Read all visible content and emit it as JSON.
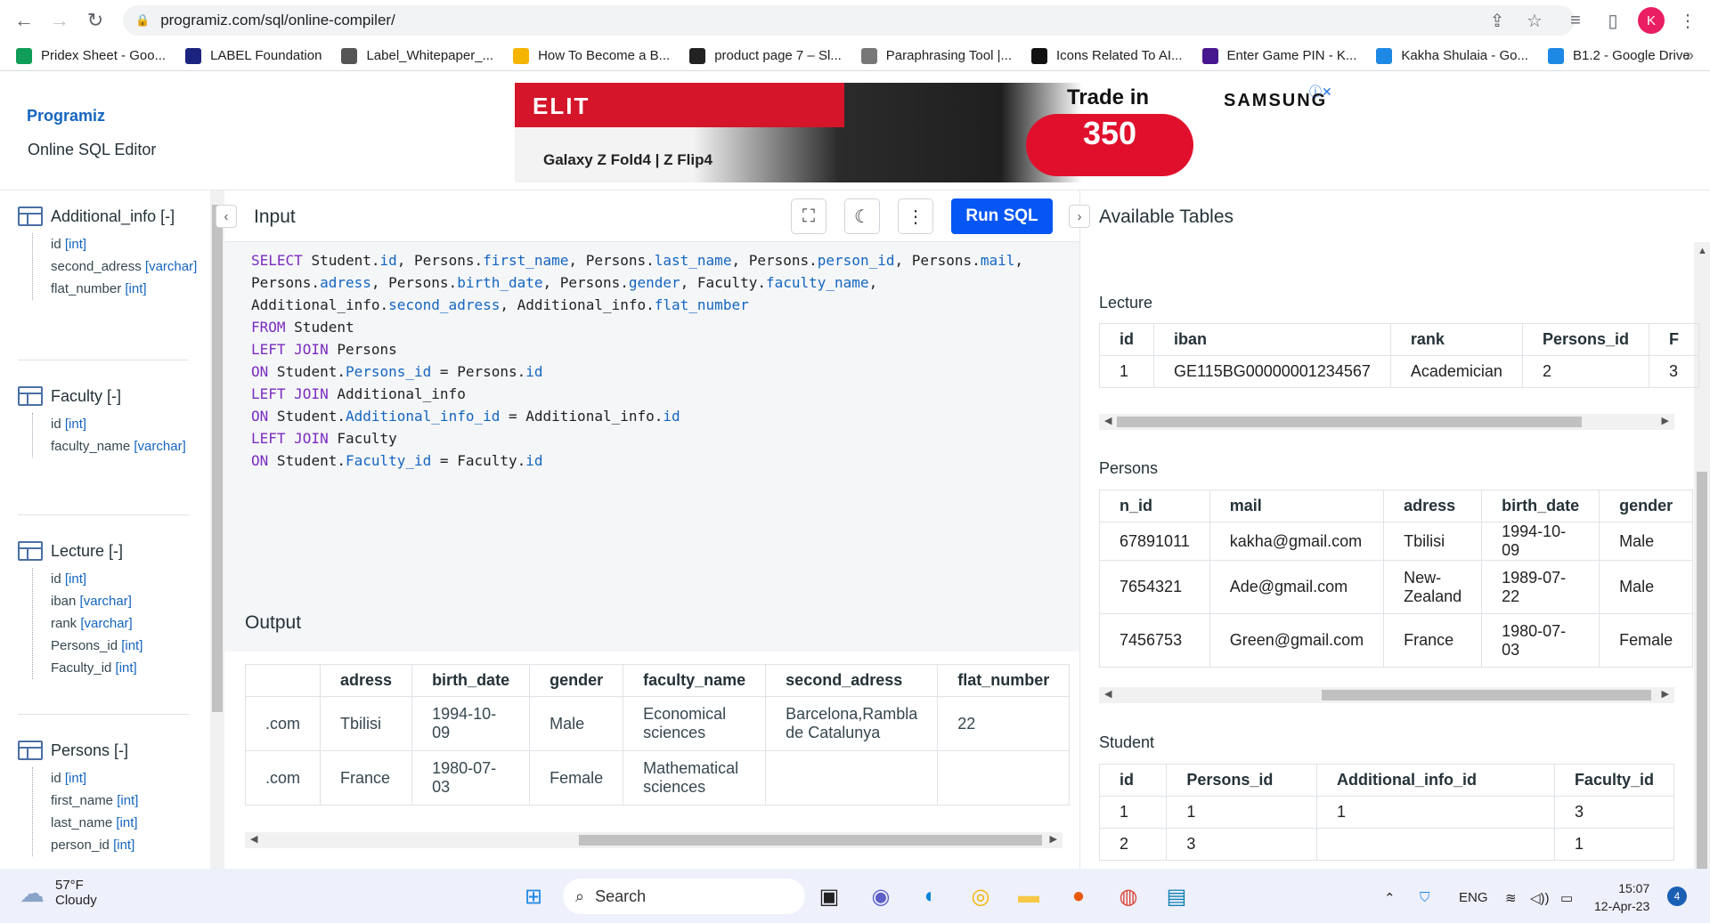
{
  "browser": {
    "url": "programiz.com/sql/online-compiler/",
    "profile_initial": "K",
    "bookmarks": [
      {
        "label": "Pridex Sheet - Goo...",
        "color": "#0f9d58"
      },
      {
        "label": "LABEL Foundation",
        "color": "#1a237e"
      },
      {
        "label": "Label_Whitepaper_...",
        "color": "#555555"
      },
      {
        "label": "How To Become a B...",
        "color": "#f4b400"
      },
      {
        "label": "product page 7 – Sl...",
        "color": "#222222"
      },
      {
        "label": "Paraphrasing Tool |...",
        "color": "#777777"
      },
      {
        "label": "Icons Related To AI...",
        "color": "#111111"
      },
      {
        "label": "Enter Game PIN - K...",
        "color": "#46178f"
      },
      {
        "label": "Kakha Shulaia - Go...",
        "color": "#1e88e5"
      },
      {
        "label": "B1.2 - Google Drive",
        "color": "#1e88e5"
      }
    ]
  },
  "header": {
    "logo": "Programiz",
    "subtitle": "Online SQL Editor"
  },
  "ad": {
    "brand1": "ELIT",
    "product": "Galaxy Z Fold4 | Z Flip4",
    "trade": "Trade in",
    "amount": "350",
    "brand2": "SAMSUNG"
  },
  "sidebar": {
    "tables": [
      {
        "name": "Additional_info [-]",
        "columns": [
          {
            "name": "id",
            "type": "[int]"
          },
          {
            "name": "second_adress",
            "type": "[varchar]"
          },
          {
            "name": "flat_number",
            "type": "[int]"
          }
        ]
      },
      {
        "name": "Faculty [-]",
        "columns": [
          {
            "name": "id",
            "type": "[int]"
          },
          {
            "name": "faculty_name",
            "type": "[varchar]"
          }
        ]
      },
      {
        "name": "Lecture [-]",
        "columns": [
          {
            "name": "id",
            "type": "[int]"
          },
          {
            "name": "iban",
            "type": "[varchar]"
          },
          {
            "name": "rank",
            "type": "[varchar]"
          },
          {
            "name": "Persons_id",
            "type": "[int]"
          },
          {
            "name": "Faculty_id",
            "type": "[int]"
          }
        ]
      },
      {
        "name": "Persons [-]",
        "columns": [
          {
            "name": "id",
            "type": "[int]"
          },
          {
            "name": "first_name",
            "type": "[int]"
          },
          {
            "name": "last_name",
            "type": "[int]"
          },
          {
            "name": "person_id",
            "type": "[int]"
          }
        ]
      }
    ]
  },
  "editor": {
    "title": "Input",
    "run_label": "Run SQL",
    "lines": [
      [
        {
          "t": "SELECT ",
          "c": "kw"
        },
        {
          "t": "Student.",
          "c": ""
        },
        {
          "t": "id",
          "c": "fd"
        },
        {
          "t": ", Persons.",
          "c": ""
        },
        {
          "t": "first_name",
          "c": "fd"
        },
        {
          "t": ", Persons.",
          "c": ""
        },
        {
          "t": "last_name",
          "c": "fd"
        },
        {
          "t": ", Persons.",
          "c": ""
        },
        {
          "t": "person_id",
          "c": "fd"
        },
        {
          "t": ", Persons.",
          "c": ""
        },
        {
          "t": "mail",
          "c": "fd"
        },
        {
          "t": ",",
          "c": ""
        }
      ],
      [
        {
          "t": "Persons.",
          "c": ""
        },
        {
          "t": "adress",
          "c": "fd"
        },
        {
          "t": ", Persons.",
          "c": ""
        },
        {
          "t": "birth_date",
          "c": "fd"
        },
        {
          "t": ", Persons.",
          "c": ""
        },
        {
          "t": "gender",
          "c": "fd"
        },
        {
          "t": ", Faculty.",
          "c": ""
        },
        {
          "t": "faculty_name",
          "c": "fd"
        },
        {
          "t": ",",
          "c": ""
        }
      ],
      [
        {
          "t": "Additional_info.",
          "c": ""
        },
        {
          "t": "second_adress",
          "c": "fd"
        },
        {
          "t": ", Additional_info.",
          "c": ""
        },
        {
          "t": "flat_number",
          "c": "fd"
        }
      ],
      [
        {
          "t": "FROM ",
          "c": "kw"
        },
        {
          "t": "Student",
          "c": ""
        }
      ],
      [
        {
          "t": "LEFT JOIN ",
          "c": "kw"
        },
        {
          "t": "Persons",
          "c": ""
        }
      ],
      [
        {
          "t": "ON ",
          "c": "kw"
        },
        {
          "t": "Student.",
          "c": ""
        },
        {
          "t": "Persons_id",
          "c": "fd"
        },
        {
          "t": " = Persons.",
          "c": ""
        },
        {
          "t": "id",
          "c": "fd"
        }
      ],
      [
        {
          "t": "LEFT JOIN ",
          "c": "kw"
        },
        {
          "t": "Additional_info",
          "c": ""
        }
      ],
      [
        {
          "t": "ON ",
          "c": "kw"
        },
        {
          "t": "Student.",
          "c": ""
        },
        {
          "t": "Additional_info_id",
          "c": "fd"
        },
        {
          "t": " = Additional_info.",
          "c": ""
        },
        {
          "t": "id",
          "c": "fd"
        }
      ],
      [
        {
          "t": "LEFT JOIN ",
          "c": "kw"
        },
        {
          "t": "Faculty",
          "c": ""
        }
      ],
      [
        {
          "t": "ON ",
          "c": "kw"
        },
        {
          "t": "Student.",
          "c": ""
        },
        {
          "t": "Faculty_id",
          "c": "fd"
        },
        {
          "t": " = Faculty.",
          "c": ""
        },
        {
          "t": "id",
          "c": "fd"
        }
      ]
    ]
  },
  "output": {
    "title": "Output",
    "headers": [
      "",
      "adress",
      "birth_date",
      "gender",
      "faculty_name",
      "second_adress",
      "flat_number"
    ],
    "rows": [
      [
        ".com",
        "Tbilisi",
        "1994-10-09",
        "Male",
        "Economical sciences",
        "Barcelona,Rambla de Catalunya",
        "22"
      ],
      [
        ".com",
        "France",
        "1980-07-03",
        "Female",
        "Mathematical sciences",
        "",
        ""
      ]
    ]
  },
  "available": {
    "title": "Available Tables",
    "lecture": {
      "title": "Lecture",
      "headers": [
        "id",
        "iban",
        "rank",
        "Persons_id",
        "F"
      ],
      "rows": [
        [
          "1",
          "GE115BG00000001234567",
          "Academician",
          "2",
          "3"
        ]
      ]
    },
    "persons": {
      "title": "Persons",
      "headers": [
        "n_id",
        "mail",
        "adress",
        "birth_date",
        "gender"
      ],
      "rows": [
        [
          "67891011",
          "kakha@gmail.com",
          "Tbilisi",
          "1994-10-09",
          "Male"
        ],
        [
          "7654321",
          "Ade@gmail.com",
          "New-Zealand",
          "1989-07-22",
          "Male"
        ],
        [
          "7456753",
          "Green@gmail.com",
          "France",
          "1980-07-03",
          "Female"
        ]
      ]
    },
    "student": {
      "title": "Student",
      "headers": [
        "id",
        "Persons_id",
        "Additional_info_id",
        "Faculty_id"
      ],
      "rows": [
        [
          "1",
          "1",
          "1",
          "3"
        ],
        [
          "2",
          "3",
          "",
          "1"
        ]
      ]
    }
  },
  "taskbar": {
    "temp": "57°F",
    "weather": "Cloudy",
    "search": "Search",
    "lang": "ENG",
    "time": "15:07",
    "date": "12-Apr-23",
    "notifications": "4"
  }
}
